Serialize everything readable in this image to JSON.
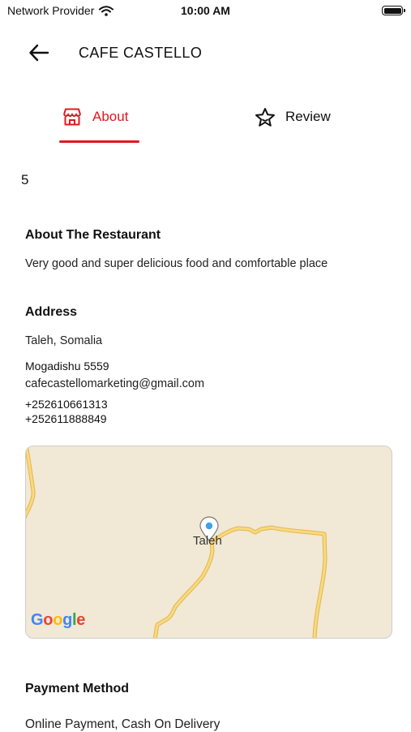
{
  "status_bar": {
    "carrier": "Network Provider",
    "time": "10:00 AM"
  },
  "header": {
    "title": "CAFE CASTELLO"
  },
  "tabs": [
    {
      "label": "About",
      "active": true
    },
    {
      "label": "Review",
      "active": false
    }
  ],
  "stray_value": "5",
  "about": {
    "heading": "About The Restaurant",
    "description": "Very good and super delicious food and comfortable place"
  },
  "address": {
    "heading": "Address",
    "location": "Taleh, Somalia",
    "line2": "Mogadishu 5559",
    "email": "cafecastellomarketing@gmail.com",
    "phone1": "+252610661313",
    "phone2": "+252611888849"
  },
  "map": {
    "place_label": "Taleh",
    "attribution": "Google"
  },
  "payment": {
    "heading": "Payment Method",
    "methods": "Online Payment, Cash On Delivery"
  },
  "colors": {
    "accent": "#e0191f",
    "map_bg": "#f1e8d6",
    "road": "#f5cf6b",
    "pin": "#3da3e8"
  }
}
